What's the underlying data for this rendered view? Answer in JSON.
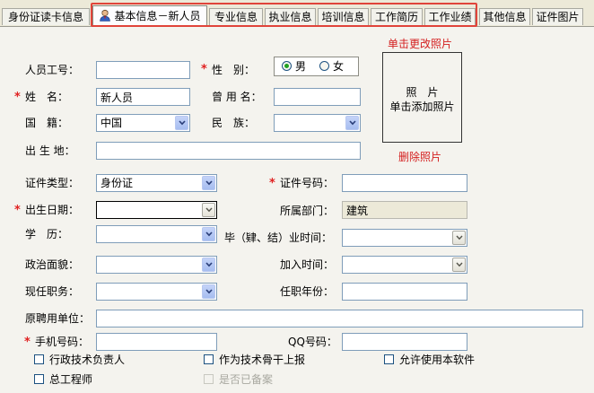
{
  "tabs": [
    {
      "label": "身份证读卡信息",
      "active": false
    },
    {
      "label": "基本信息－新人员",
      "active": true,
      "icon": "user-icon"
    },
    {
      "label": "专业信息",
      "active": false
    },
    {
      "label": "执业信息",
      "active": false
    },
    {
      "label": "培训信息",
      "active": false
    },
    {
      "label": "工作简历",
      "active": false
    },
    {
      "label": "工作业绩",
      "active": false
    },
    {
      "label": "其他信息",
      "active": false
    },
    {
      "label": "证件图片",
      "active": false
    }
  ],
  "colors": {
    "required": "#e02020",
    "highlight": "#e0443a",
    "link": "#d42020",
    "input_border": "#7f9db9"
  },
  "form": {
    "required_mark": "*",
    "employee_no": {
      "label": "人员工号：",
      "value": ""
    },
    "gender": {
      "label": "性　别：",
      "options": [
        "男",
        "女"
      ],
      "selected": "男"
    },
    "name": {
      "label": "姓　名：",
      "value": "新人员"
    },
    "former_name": {
      "label": "曾 用 名：",
      "value": ""
    },
    "nationality": {
      "label": "国　籍：",
      "value": "中国"
    },
    "ethnicity": {
      "label": "民　族：",
      "value": ""
    },
    "birthplace": {
      "label": "出 生 地：",
      "value": ""
    },
    "id_type": {
      "label": "证件类型：",
      "value": "身份证"
    },
    "id_number": {
      "label": "证件号码：",
      "value": ""
    },
    "birth_date": {
      "label": "出生日期：",
      "value": ""
    },
    "department": {
      "label": "所属部门：",
      "value": "建筑"
    },
    "education": {
      "label": "学　历：",
      "value": ""
    },
    "graduation_time": {
      "label": "毕（肄、结）业时间：",
      "value": ""
    },
    "political_status": {
      "label": "政治面貌：",
      "value": ""
    },
    "join_time": {
      "label": "加入时间：",
      "value": ""
    },
    "current_position": {
      "label": "现任职务：",
      "value": ""
    },
    "tenure_years": {
      "label": "任职年份：",
      "value": ""
    },
    "former_employer": {
      "label": "原聘用单位：",
      "value": ""
    },
    "mobile": {
      "label": "手机号码：",
      "value": ""
    },
    "qq": {
      "label": "QQ号码：",
      "value": ""
    }
  },
  "photo": {
    "change_link": "单击更改照片",
    "placeholder_line1": "照　片",
    "placeholder_line2": "单击添加照片",
    "delete_link": "删除照片"
  },
  "checkboxes": [
    {
      "label": "行政技术负责人",
      "checked": false,
      "enabled": true
    },
    {
      "label": "作为技术骨干上报",
      "checked": false,
      "enabled": true
    },
    {
      "label": "允许使用本软件",
      "checked": false,
      "enabled": true
    },
    {
      "label": "总工程师",
      "checked": false,
      "enabled": true
    },
    {
      "label": "是否已备案",
      "checked": false,
      "enabled": false
    }
  ]
}
